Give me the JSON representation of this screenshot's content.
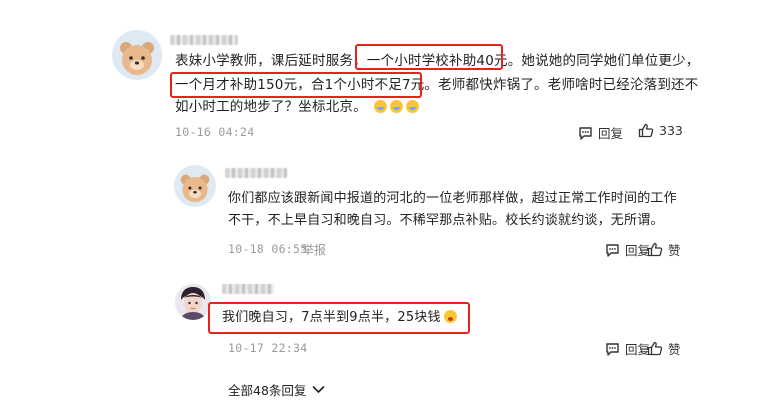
{
  "comment_main": {
    "line1_prefix": "表妹小学教师，课后延时服务，",
    "line1_highlight": "一个小时学校补助40元。",
    "line1_suffix": "她说她的同学她们单位更少，",
    "line2_highlight": "一个月才补助150元，合1个小时不足7元。",
    "line2_suffix": "老师都快炸锅了。老师啥时已经沦落到还不",
    "line3": "如小时工的地步了？坐标北京。",
    "date": "10-16 04:24",
    "reply_label": "回复",
    "like_count": "333",
    "emojis": [
      "crying-laughing",
      "crying-laughing",
      "crying-laughing"
    ]
  },
  "reply_1": {
    "line1": "你们都应该跟新闻中报道的河北的一位老师那样做，超过正常工作时间的工作",
    "line2": "不干，不上早自习和晚自习。不稀罕那点补贴。校长约谈就约谈，无所谓。",
    "date": "10-18 06:55",
    "report_label": "举报",
    "reply_label": "回复",
    "like_label": "赞"
  },
  "reply_2": {
    "text": "我们晚自习，7点半到9点半，25块钱",
    "emoji": "grinning-tongue",
    "date": "10-17 22:34",
    "reply_label": "回复",
    "like_label": "赞"
  },
  "footer": {
    "all_replies_label": "全部48条回复"
  },
  "colors": {
    "highlight_box": "#e8231f",
    "meta_text": "#9a9a9a"
  }
}
